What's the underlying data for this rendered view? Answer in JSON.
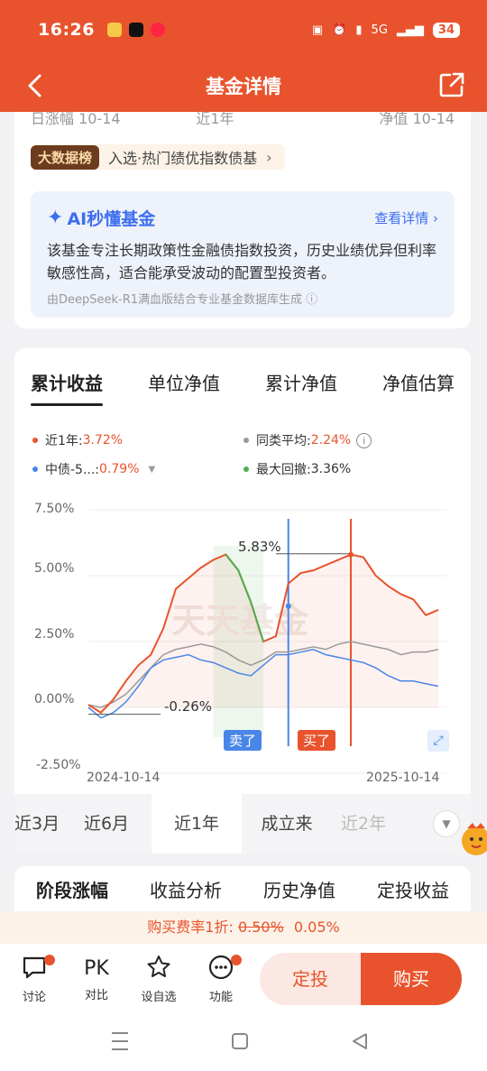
{
  "status": {
    "time": "16:26",
    "battery": "34",
    "network": "5G"
  },
  "nav": {
    "title": "基金详情"
  },
  "top_stats": {
    "day_change": "日涨幅 10-14",
    "range": "近1年",
    "nav_date": "净值 10-14"
  },
  "ranking": {
    "tag": "大数据榜",
    "text": "入选·热门绩优指数债基",
    "arrow": "›"
  },
  "ai": {
    "title": "AI秒懂基金",
    "more": "查看详情 ›",
    "body": "该基金专注长期政策性金融债指数投资，历史业绩优异但利率敏感性高，适合能承受波动的配置型投资者。",
    "footer": "由DeepSeek-R1满血版结合专业基金数据库生成 ⓘ"
  },
  "chart_tabs": [
    "累计收益",
    "单位净值",
    "累计净值",
    "净值估算"
  ],
  "legend": {
    "fund_label": "近1年:",
    "fund_value": "3.72%",
    "peer_label": "同类平均:",
    "peer_value": "2.24%",
    "index_label": "中债-5...:",
    "index_value": "0.79%",
    "drawdown_label": "最大回撤:",
    "drawdown_value": "3.36%"
  },
  "colors": {
    "fund": "#e8532d",
    "peer": "#9a9a9a",
    "index": "#4a86e8",
    "drawdown": "#4caf50"
  },
  "chart_data": {
    "type": "line",
    "x_start": "2024-10-14",
    "x_end": "2025-10-14",
    "ylim": [
      -2.5,
      7.5
    ],
    "yticks": [
      "7.50%",
      "5.00%",
      "2.50%",
      "0.00%",
      "-2.50%"
    ],
    "series": [
      {
        "name": "近1年",
        "values": [
          0.1,
          -0.2,
          0.3,
          1.0,
          1.6,
          2.0,
          3.0,
          4.5,
          4.9,
          5.3,
          5.6,
          5.8,
          5.2,
          4.0,
          2.5,
          2.7,
          4.7,
          5.1,
          5.2,
          5.4,
          5.6,
          5.8,
          5.7,
          5.0,
          4.6,
          4.3,
          4.1,
          3.5,
          3.7
        ]
      },
      {
        "name": "同类平均",
        "values": [
          0.1,
          0.0,
          0.2,
          0.5,
          1.0,
          1.5,
          2.0,
          2.2,
          2.3,
          2.4,
          2.3,
          2.1,
          1.8,
          1.6,
          1.8,
          2.1,
          2.1,
          2.2,
          2.3,
          2.2,
          2.4,
          2.5,
          2.4,
          2.3,
          2.2,
          2.0,
          2.1,
          2.1,
          2.2
        ]
      },
      {
        "name": "中债-5...",
        "values": [
          0.0,
          -0.4,
          -0.2,
          0.2,
          0.8,
          1.5,
          1.8,
          1.9,
          2.0,
          1.8,
          1.7,
          1.5,
          1.3,
          1.2,
          1.6,
          2.0,
          2.0,
          2.1,
          2.2,
          2.0,
          1.9,
          1.8,
          1.7,
          1.5,
          1.2,
          1.0,
          1.0,
          0.9,
          0.8
        ]
      }
    ],
    "annotations": {
      "high": "5.83%",
      "low": "-0.26%",
      "sell": "卖了",
      "buy": "买了"
    },
    "watermark": "天天基金"
  },
  "periods": [
    "近3月",
    "近6月",
    "近1年",
    "成立来",
    "近2年"
  ],
  "active_period": "近1年",
  "section_tabs": [
    "阶段涨幅",
    "收益分析",
    "历史净值",
    "定投收益"
  ],
  "fee": {
    "prefix": "购买费率1折:",
    "old": "0.50%",
    "new": "0.05%"
  },
  "bottom": {
    "items": [
      {
        "label": "讨论"
      },
      {
        "label": "对比"
      },
      {
        "label": "设自选"
      },
      {
        "label": "功能"
      }
    ],
    "pk": "PK",
    "dingtou": "定投",
    "buy": "购买"
  }
}
